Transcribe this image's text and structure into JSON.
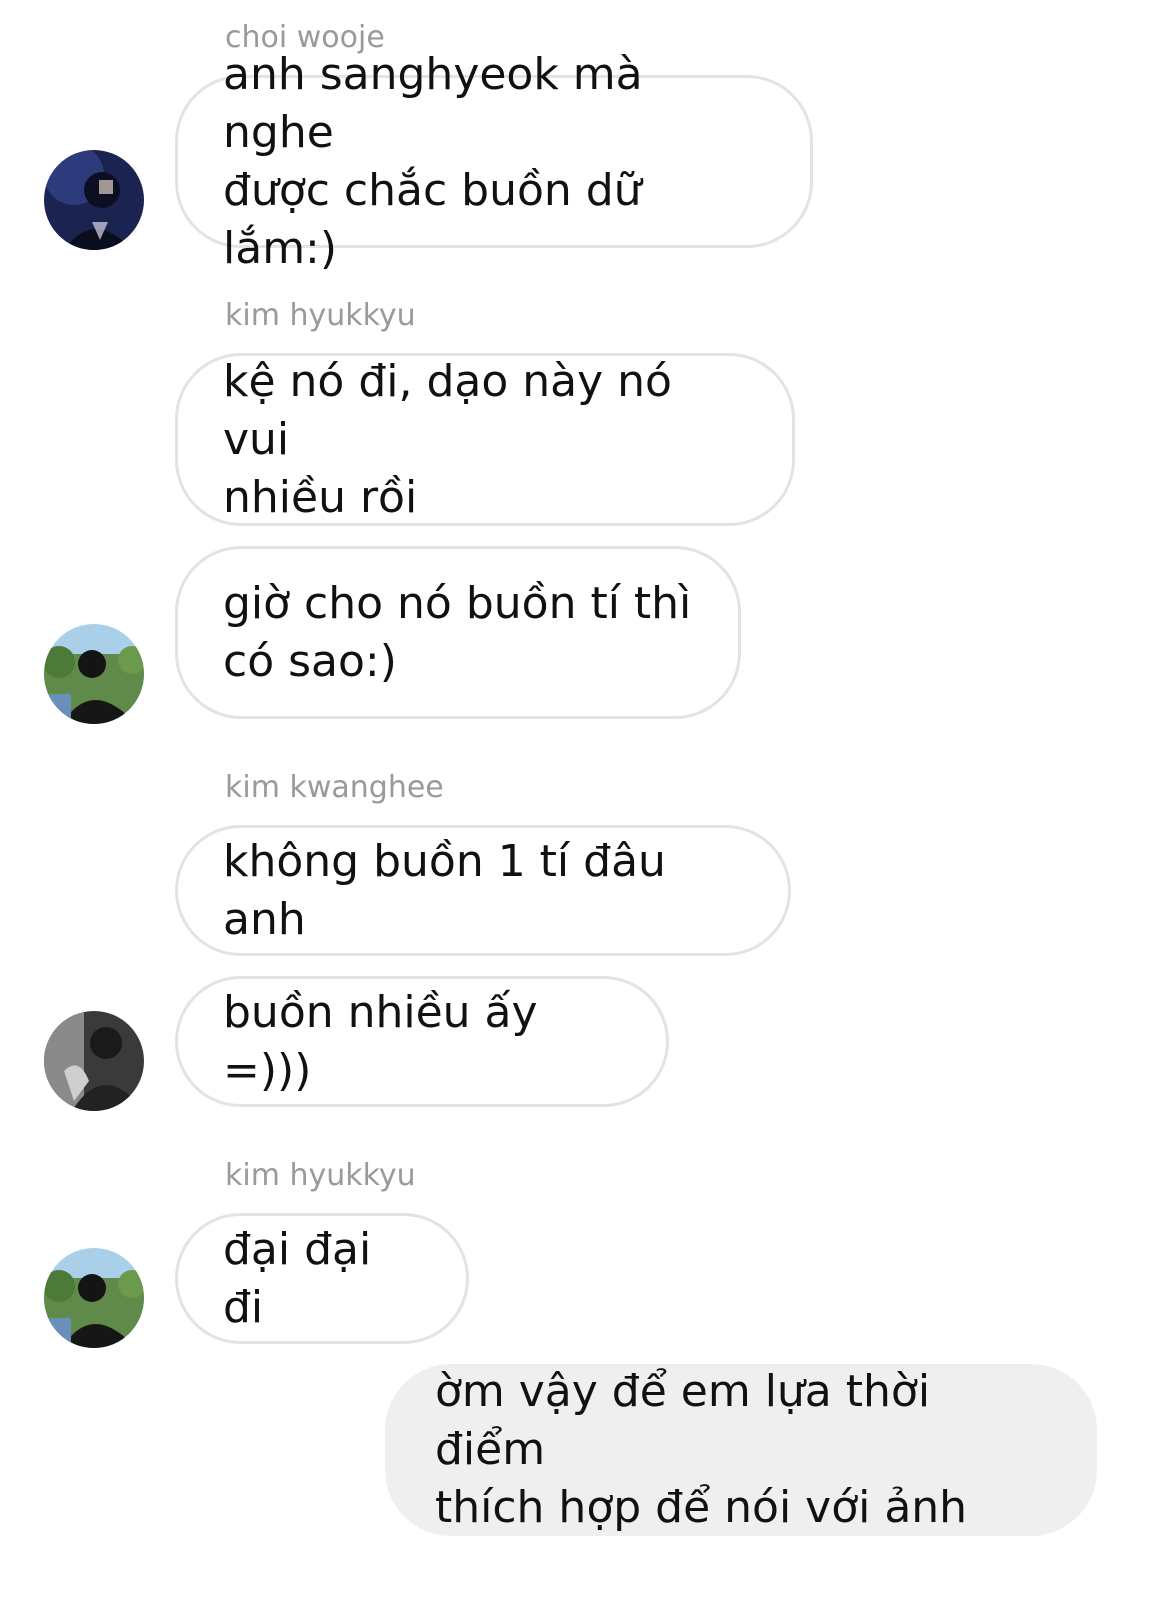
{
  "messages": [
    {
      "sender": "choi wooje",
      "text": "anh sanghyeok mà nghe\nđược chắc buồn dữ lắm:)"
    },
    {
      "sender": "kim hyukkyu",
      "text": "kệ nó đi, dạo này nó vui\nnhiều rồi"
    },
    {
      "text": "giờ cho nó buồn tí thì\ncó sao:)"
    },
    {
      "sender": "kim kwanghee",
      "text": "không buồn 1 tí đâu anh"
    },
    {
      "text": "buồn nhiều ấy =)))"
    },
    {
      "sender": "kim hyukkyu",
      "text": "đại đại đi"
    },
    {
      "text": "ờm vậy để em lựa thời điểm\nthích hợp để nói với ảnh"
    }
  ],
  "avatars": [
    {
      "user": "choi wooje",
      "style": "dark-navy"
    },
    {
      "user": "kim hyukkyu",
      "style": "park-outdoor"
    },
    {
      "user": "kim kwanghee",
      "style": "black-and-white"
    },
    {
      "user": "kim hyukkyu",
      "style": "park-outdoor"
    }
  ]
}
